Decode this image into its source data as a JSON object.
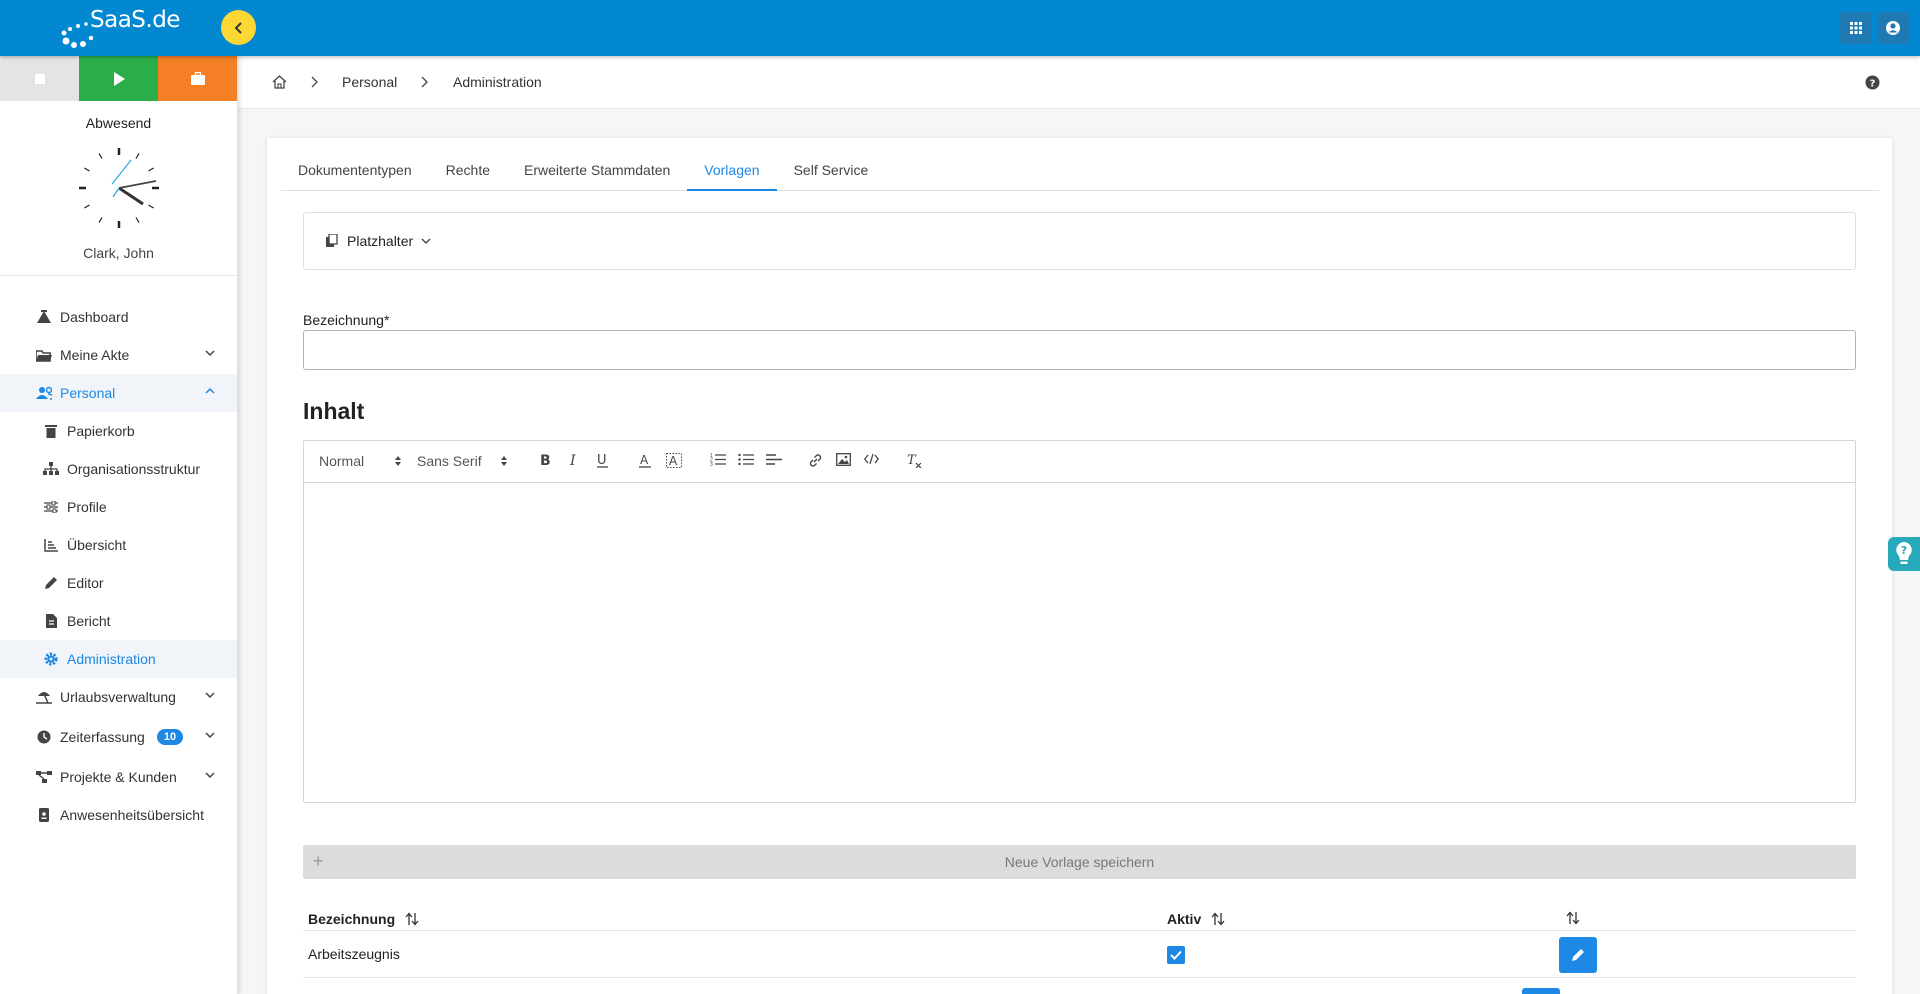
{
  "app": {
    "logo_text": "SaaS.de"
  },
  "timer": {
    "status": "Abwesend",
    "user": "Clark, John"
  },
  "sidebar": {
    "items": [
      {
        "label": "Dashboard"
      },
      {
        "label": "Meine Akte"
      },
      {
        "label": "Personal"
      },
      {
        "label": "Papierkorb"
      },
      {
        "label": "Organisationsstruktur"
      },
      {
        "label": "Profile"
      },
      {
        "label": "Übersicht"
      },
      {
        "label": "Editor"
      },
      {
        "label": "Bericht"
      },
      {
        "label": "Administration"
      },
      {
        "label": "Urlaubsverwaltung"
      },
      {
        "label": "Zeiterfassung",
        "badge": "10"
      },
      {
        "label": "Projekte & Kunden"
      },
      {
        "label": "Anwesenheitsübersicht"
      }
    ]
  },
  "breadcrumb": {
    "level1": "Personal",
    "level2": "Administration"
  },
  "tabs": [
    "Dokumententypen",
    "Rechte",
    "Erweiterte Stammdaten",
    "Vorlagen",
    "Self Service"
  ],
  "placeholder_menu": {
    "label": "Platzhalter"
  },
  "form": {
    "name_label": "Bezeichnung",
    "required_mark": "*",
    "name_value": ""
  },
  "content": {
    "title": "Inhalt"
  },
  "editor": {
    "format": "Normal",
    "font": "Sans Serif"
  },
  "save": {
    "label": "Neue Vorlage speichern"
  },
  "table": {
    "headers": {
      "name": "Bezeichnung",
      "active": "Aktiv"
    },
    "rows": [
      {
        "name": "Arbeitszeugnis",
        "active": true
      }
    ]
  },
  "colors": {
    "topbar": "#0288d1",
    "accent": "#1e88e5",
    "play": "#2bae4a",
    "briefcase": "#f57f25",
    "collapse": "#fdd835"
  }
}
